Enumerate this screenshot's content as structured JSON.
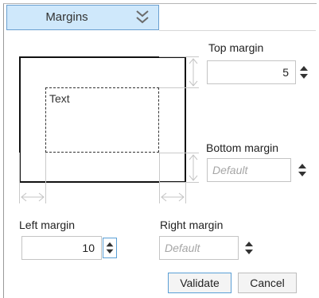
{
  "tab": {
    "label": "Margins",
    "icon": "double-chevron-down-icon"
  },
  "preview": {
    "text": "Text"
  },
  "fields": {
    "top": {
      "label": "Top margin",
      "value": "5",
      "placeholder": ""
    },
    "bottom": {
      "label": "Bottom margin",
      "value": "",
      "placeholder": "Default"
    },
    "left": {
      "label": "Left margin",
      "value": "10",
      "placeholder": ""
    },
    "right": {
      "label": "Right margin",
      "value": "",
      "placeholder": "Default"
    }
  },
  "buttons": {
    "validate": "Validate",
    "cancel": "Cancel"
  },
  "colors": {
    "tab_bg": "#cfe8fb",
    "accent": "#5a9fd6"
  }
}
